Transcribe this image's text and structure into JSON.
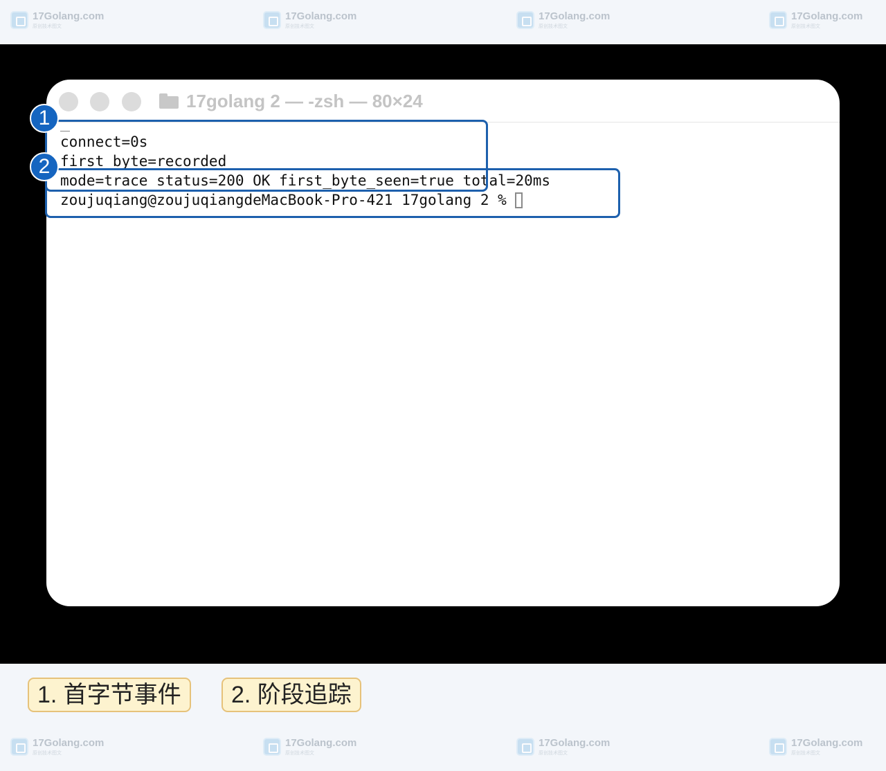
{
  "watermark": {
    "name": "17Golang.com",
    "sub": "原创技术图文"
  },
  "window": {
    "title": "17golang 2 — -zsh — 80×24"
  },
  "terminal": {
    "lines": [
      "connect=0s",
      "first_byte=recorded",
      "mode=trace status=200 OK first_byte_seen=true total=20ms"
    ],
    "prompt": "zoujuqiang@zoujuqiangdeMacBook-Pro-421 17golang 2 %"
  },
  "badges": [
    "1",
    "2"
  ],
  "legend": [
    "1. 首字节事件",
    "2. 阶段追踪"
  ],
  "colors": {
    "highlight": "#1d60ad",
    "badge": "#1565c0",
    "legend_bg": "#fdf3cf",
    "legend_border": "#e6c27a"
  }
}
